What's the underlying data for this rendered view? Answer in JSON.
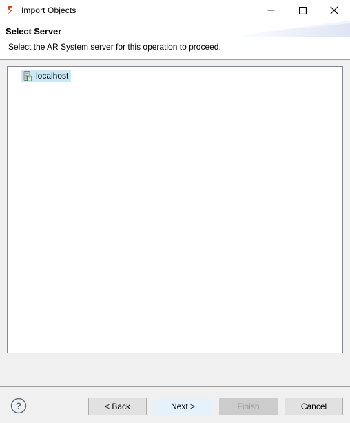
{
  "window": {
    "title": "Import Objects",
    "app_icon": "bmc-studio-icon",
    "controls": [
      {
        "name": "minimize",
        "glyph": "minimize-icon"
      },
      {
        "name": "maximize",
        "glyph": "maximize-icon"
      },
      {
        "name": "close",
        "glyph": "close-icon"
      }
    ]
  },
  "header": {
    "title": "Select Server",
    "description": "Select the AR System server for this operation to proceed.",
    "banner_accent": "#dfe6f5"
  },
  "tree": {
    "items": [
      {
        "label": "localhost",
        "icon": "server-icon",
        "selected": true,
        "selection_color": "#cbe8f6"
      }
    ]
  },
  "footer": {
    "help_label": "?",
    "help_icon": "question-circle-icon",
    "buttons": [
      {
        "name": "back",
        "label": "< Back",
        "state": "enabled"
      },
      {
        "name": "next",
        "label": "Next >",
        "state": "default"
      },
      {
        "name": "finish",
        "label": "Finish",
        "state": "disabled"
      },
      {
        "name": "cancel",
        "label": "Cancel",
        "state": "enabled"
      }
    ]
  },
  "colors": {
    "accent": "#0078d7",
    "app_icon": "#e8562a",
    "panel_border": "#828790",
    "surface": "#f0f0f0",
    "disabled_text": "#9a9a9a"
  }
}
